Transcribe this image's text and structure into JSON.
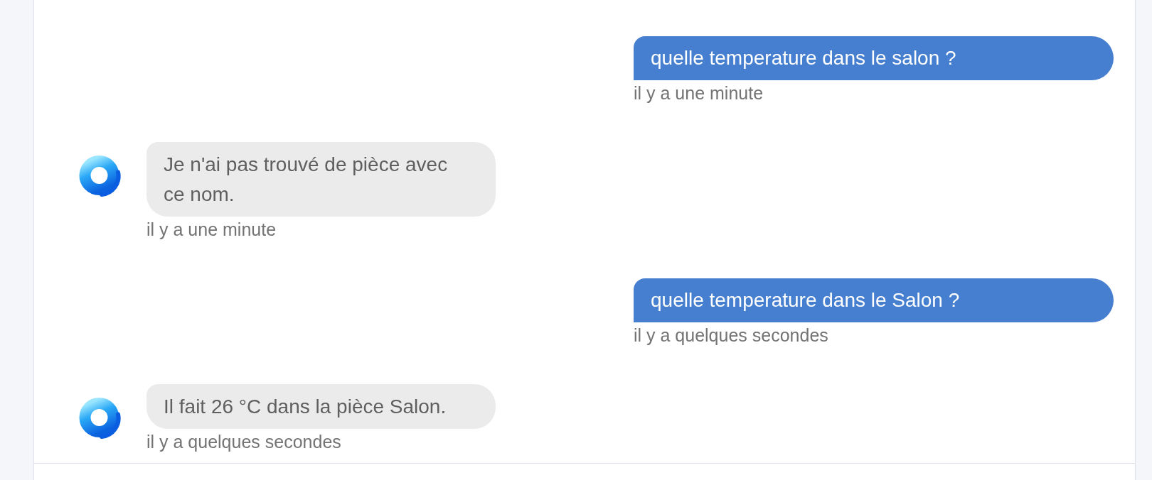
{
  "messages": [
    {
      "kind": "user",
      "text": "quelle temperature dans le salon ?",
      "time": "il y a une minute"
    },
    {
      "kind": "assistant",
      "text": "Je n'ai pas trouvé de pièce avec ce nom.",
      "time": "il y a une minute"
    },
    {
      "kind": "user",
      "text": "quelle temperature dans le Salon ?",
      "time": "il y a quelques secondes"
    },
    {
      "kind": "assistant",
      "text": "Il fait 26 °C dans la pièce Salon.",
      "time": "il y a quelques secondes"
    }
  ]
}
